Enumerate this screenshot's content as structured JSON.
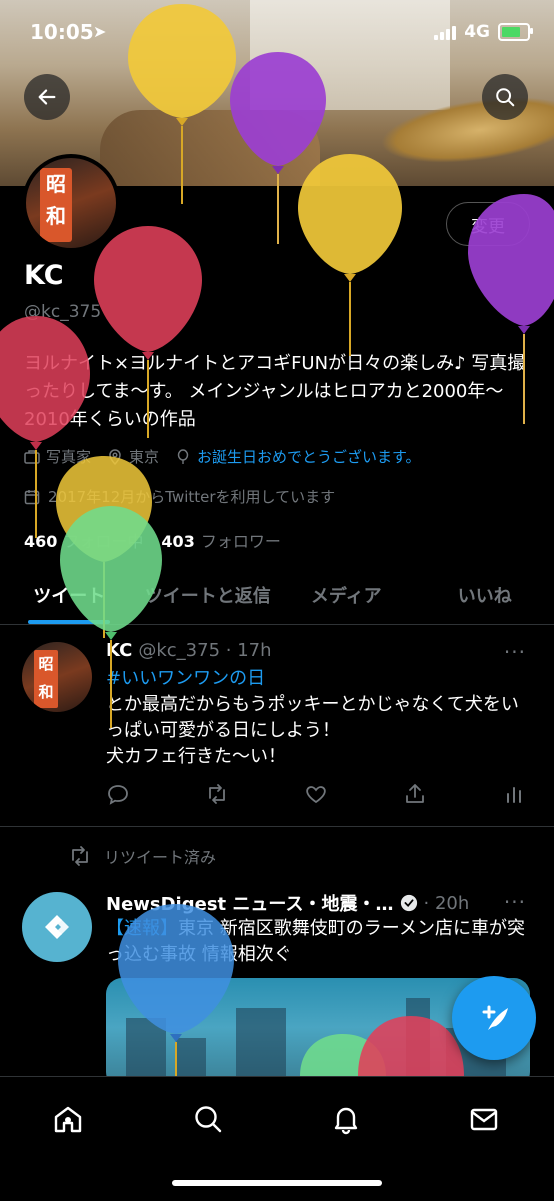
{
  "status_bar": {
    "time": "10:05",
    "network": "4G"
  },
  "header": {
    "back_icon": "back-arrow-icon",
    "search_icon": "search-icon"
  },
  "profile": {
    "avatar_text": "昭和",
    "edit_button": "変更",
    "name": "KC",
    "handle": "@kc_375",
    "bio": "ヨルナイト×ヨルナイトとアコギFUNが日々の楽しみ♪ 写真撮ったりしてま〜す。 メインジャンルはヒロアカと2000年〜2010年くらいの作品",
    "category": "写真家",
    "location": "東京",
    "birthday": "お誕生日おめでとうございます。",
    "joined": "2017年12月からTwitterを利用しています",
    "following_count": "460",
    "following_label": "フォロー中",
    "followers_count": "403",
    "followers_label": "フォロワー"
  },
  "tabs": [
    {
      "label": "ツイート",
      "active": true
    },
    {
      "label": "ツイートと返信",
      "active": false
    },
    {
      "label": "メディア",
      "active": false
    },
    {
      "label": "いいね",
      "active": false
    }
  ],
  "tweets": [
    {
      "avatar_text": "昭和",
      "name": "KC",
      "handle_time": "@kc_375 · 17h",
      "hashtag": "#いいワンワンの日",
      "text": "とか最高だからもうポッキーとかじゃなくて犬をいっぱい可愛がる日にしよう！\n犬カフェ行きた〜い！",
      "more": "···"
    },
    {
      "retweet_label": "リツイート済み",
      "name": "NewsDigest ニュース・地震・…",
      "time": "· 20h",
      "tag": "【速報】",
      "text": "東京 新宿区歌舞伎町のラーメン店に車が突っ込む事故 情報相次ぐ",
      "more": "···"
    }
  ],
  "bottom_nav": [
    "home-icon",
    "search-icon",
    "notifications-icon",
    "messages-icon"
  ],
  "colors": {
    "accent": "#1d9bf0",
    "muted": "#71767b",
    "background": "#000000"
  }
}
